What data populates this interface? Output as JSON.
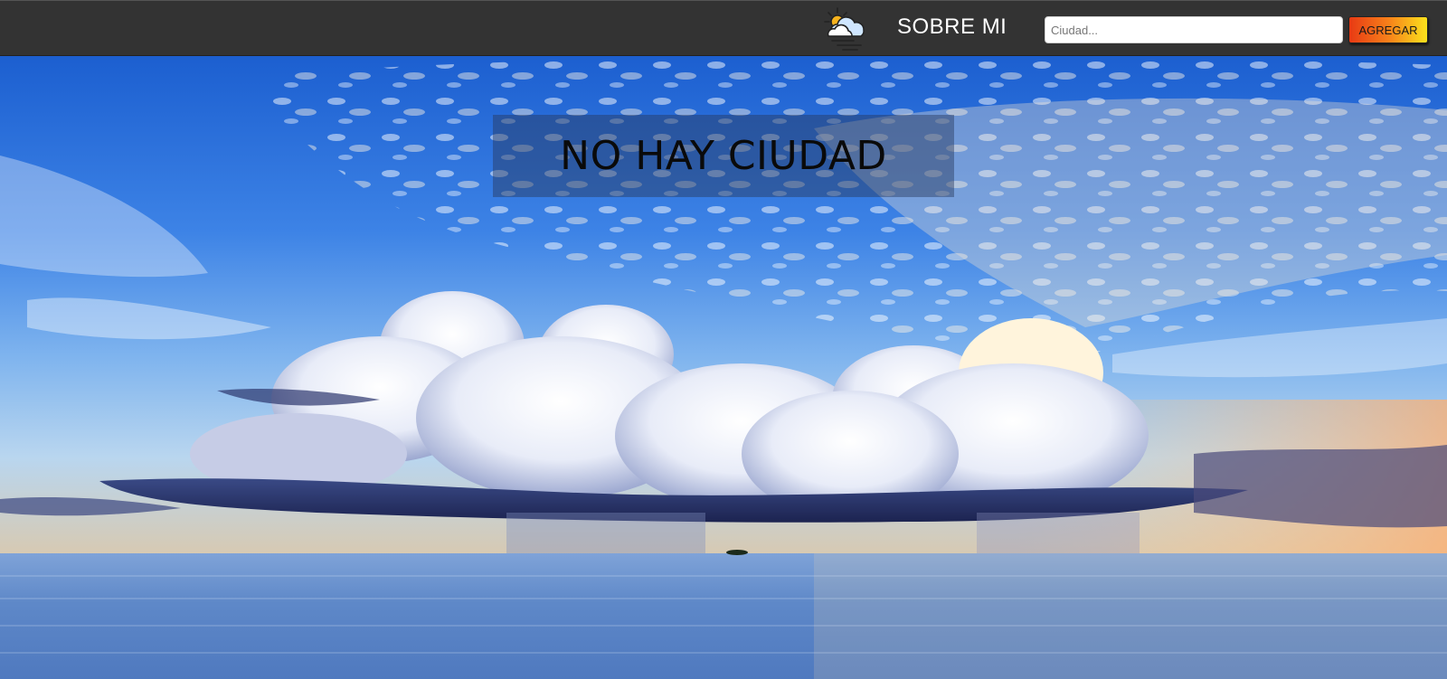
{
  "navbar": {
    "logo_icon": "weather-cloud-sun-icon",
    "about_label": "SOBRE MI",
    "search": {
      "placeholder": "Ciudad...",
      "value": ""
    },
    "add_label": "AGREGAR",
    "colors": {
      "bar": "#333333",
      "button_from": "#e83a14",
      "button_to": "#fbe21c"
    }
  },
  "main": {
    "background": "sky-clouds-ocean-photo",
    "city_title": "NO HAY CIUDAD"
  }
}
